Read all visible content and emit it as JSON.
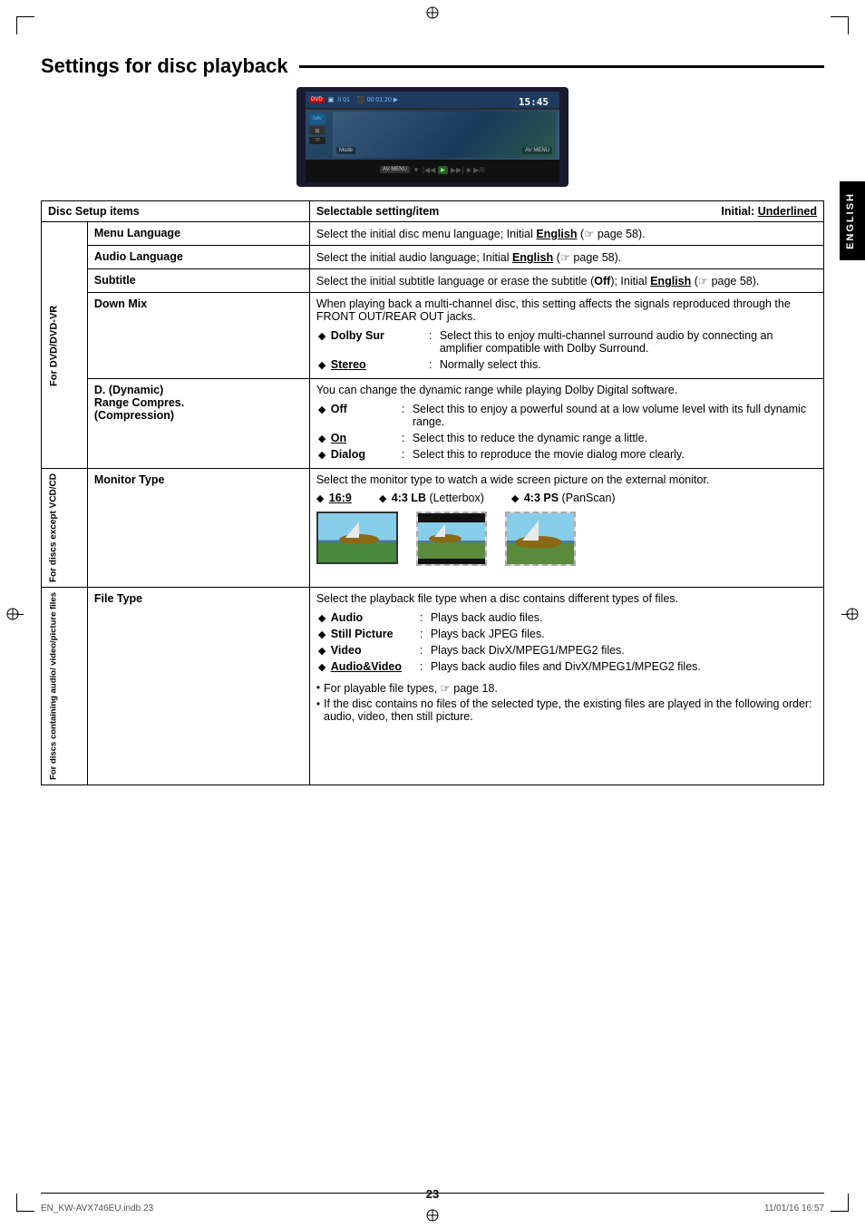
{
  "page": {
    "title": "Settings for disc playback",
    "page_number": "23",
    "footer_left": "EN_KW-AVX746EU.indb  23",
    "footer_right": "11/01/16   16:57"
  },
  "english_tab": "ENGLISH",
  "device": {
    "time": "15:45",
    "track": "01",
    "counter": "00:01:20"
  },
  "table": {
    "header": {
      "col1": "Disc Setup items",
      "col2": "Selectable setting/item",
      "initial_label": "Initial:",
      "initial_value": "Underlined"
    },
    "sections": [
      {
        "category": "For DVD/DVD-VR",
        "rows": [
          {
            "item": "Menu Language",
            "description": "Select the initial disc menu language; Initial English (☞ page 58)."
          },
          {
            "item": "Audio Language",
            "description": "Select the initial audio language; Initial English (☞ page 58)."
          },
          {
            "item": "Subtitle",
            "description": "Select the initial subtitle language or erase the subtitle (Off); Initial English (☞ page 58)."
          },
          {
            "item": "Down Mix",
            "description": "When playing back a multi-channel disc, this setting affects the signals reproduced through the FRONT OUT/REAR OUT jacks.",
            "settings": [
              {
                "label": "◆ Dolby Sur",
                "desc": "Select this to enjoy multi-channel surround audio by connecting an amplifier compatible with Dolby Surround."
              },
              {
                "label": "◆ Stereo",
                "underline": true,
                "desc": "Normally select this."
              }
            ]
          },
          {
            "item": "D. (Dynamic)\nRange Compres.\n(Compression)",
            "description": "You can change the dynamic range while playing Dolby Digital software.",
            "settings": [
              {
                "label": "◆ Off",
                "underline": false,
                "desc": "Select this to enjoy a powerful sound at a low volume level with its full dynamic range."
              },
              {
                "label": "◆ On",
                "underline": true,
                "desc": "Select this to reduce the dynamic range a little."
              },
              {
                "label": "◆ Dialog",
                "underline": false,
                "desc": "Select this to reproduce the movie dialog more clearly."
              }
            ]
          }
        ]
      },
      {
        "category": "For discs except VCD/CD",
        "rows": [
          {
            "item": "Monitor Type",
            "description": "Select the monitor type to watch a wide screen picture on the external monitor.",
            "settings": [
              {
                "label": "◆ 16:9",
                "underline": true
              },
              {
                "label": "◆ 4:3 LB",
                "suffix": "(Letterbox)"
              },
              {
                "label": "◆ 4:3 PS",
                "suffix": "(PanScan)"
              }
            ],
            "has_images": true
          }
        ]
      },
      {
        "category": "For discs containing audio/video/picture files",
        "rows": [
          {
            "item": "File Type",
            "description": "Select the playback file type when a disc contains different types of files.",
            "settings": [
              {
                "label": "◆ Audio",
                "underline": false,
                "desc": "Plays back audio files."
              },
              {
                "label": "◆ Still Picture",
                "underline": false,
                "desc": "Plays back JPEG files."
              },
              {
                "label": "◆ Video",
                "underline": false,
                "desc": "Plays back DivX/MPEG1/MPEG2 files."
              },
              {
                "label": "◆ Audio&Video",
                "underline": true,
                "desc": "Plays back audio files and DivX/MPEG1/MPEG2 files."
              }
            ],
            "notes": [
              "For playable file types, ☞ page 18.",
              "If the disc contains no files of the selected type, the existing files are played in the following order: audio, video, then still picture."
            ]
          }
        ]
      }
    ]
  }
}
